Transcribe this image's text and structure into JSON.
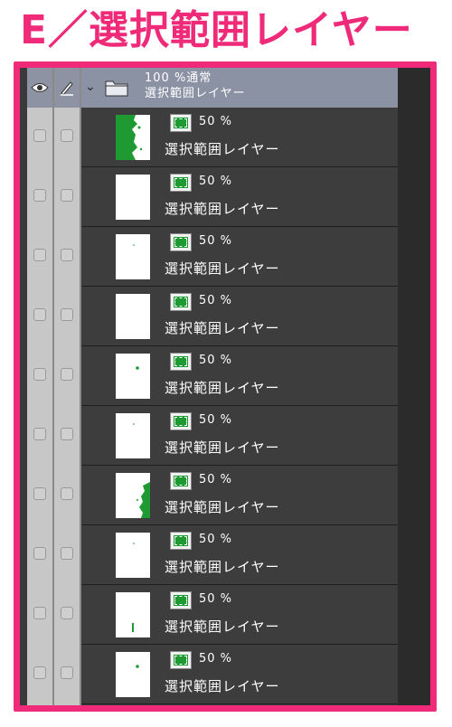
{
  "heading": "E／選択範囲レイヤー",
  "folder": {
    "line1": "100 %通常",
    "line2": "選択範囲レイヤー"
  },
  "layers": [
    {
      "opacity": "50 %",
      "name": "選択範囲レイヤー",
      "thumb": "edge-left-large"
    },
    {
      "opacity": "50 %",
      "name": "選択範囲レイヤー",
      "thumb": "blank"
    },
    {
      "opacity": "50 %",
      "name": "選択範囲レイヤー",
      "thumb": "tiny"
    },
    {
      "opacity": "50 %",
      "name": "選択範囲レイヤー",
      "thumb": "blank"
    },
    {
      "opacity": "50 %",
      "name": "選択範囲レイヤー",
      "thumb": "dot"
    },
    {
      "opacity": "50 %",
      "name": "選択範囲レイヤー",
      "thumb": "tiny"
    },
    {
      "opacity": "50 %",
      "name": "選択範囲レイヤー",
      "thumb": "edge-right"
    },
    {
      "opacity": "50 %",
      "name": "選択範囲レイヤー",
      "thumb": "tiny"
    },
    {
      "opacity": "50 %",
      "name": "選択範囲レイヤー",
      "thumb": "speck-bottom"
    },
    {
      "opacity": "50 %",
      "name": "選択範囲レイヤー",
      "thumb": "dot"
    }
  ],
  "colors": {
    "accent": "#ee2a79",
    "selection_green": "#1f9a32",
    "folder_header": "#8a92a4"
  }
}
